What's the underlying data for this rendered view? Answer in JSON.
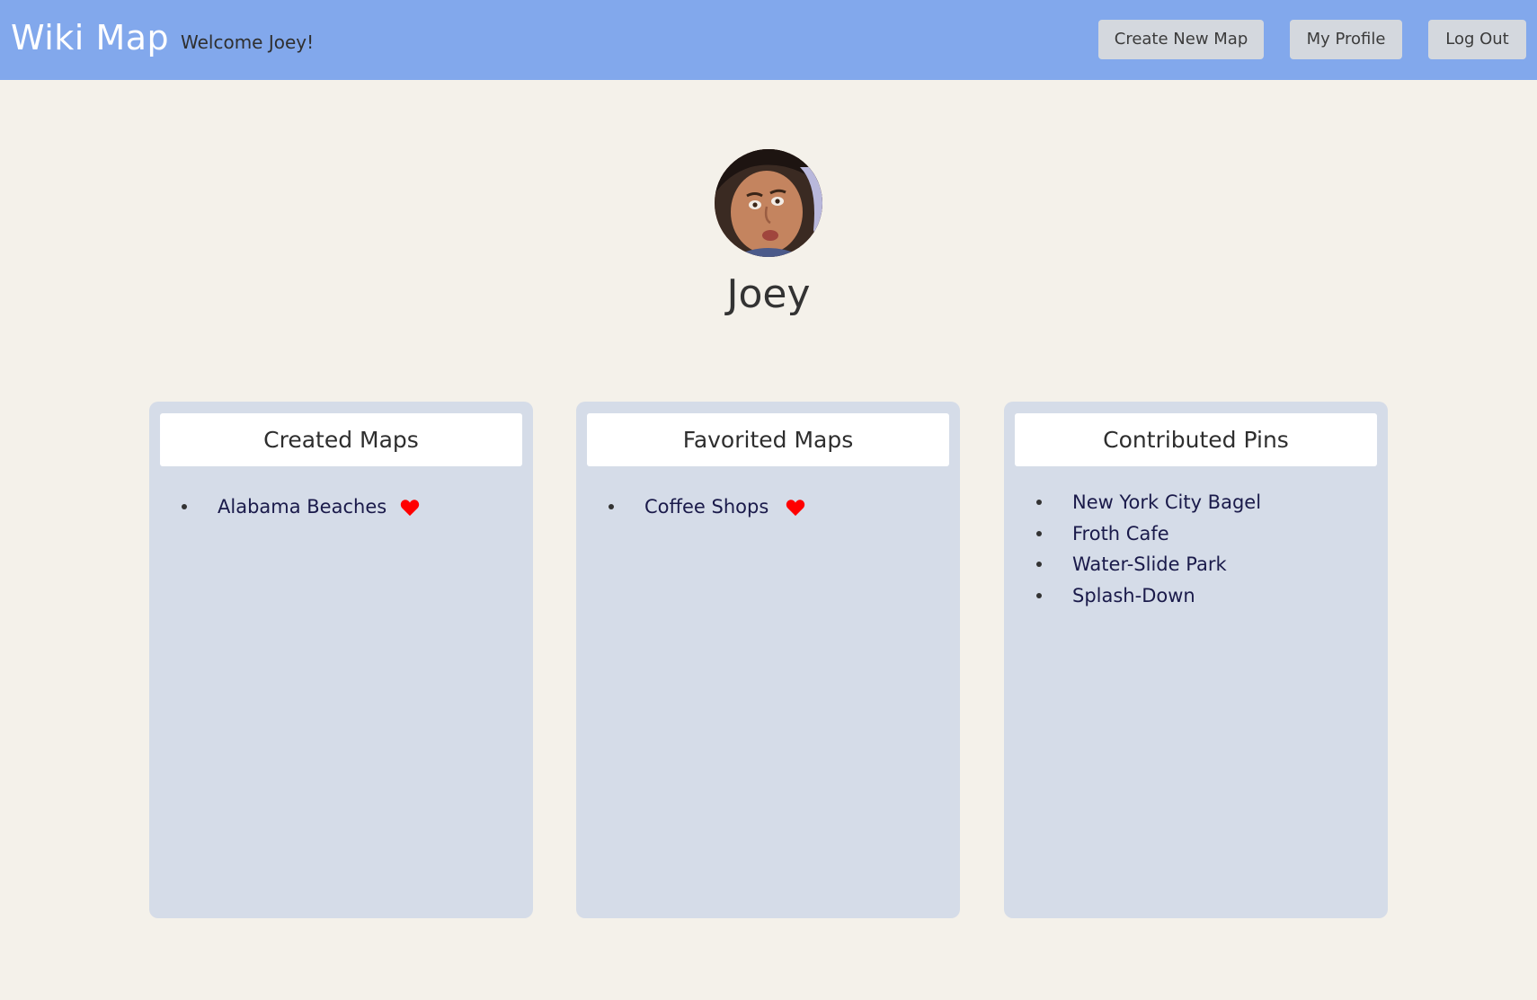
{
  "header": {
    "brand": "Wiki Map",
    "welcome": "Welcome Joey!",
    "buttons": {
      "create_new_map": "Create New Map",
      "my_profile": "My Profile",
      "log_out": "Log Out"
    }
  },
  "profile": {
    "name": "Joey",
    "avatar": "profile-photo"
  },
  "cards": {
    "created": {
      "title": "Created Maps",
      "items": [
        {
          "label": "Alabama Beaches",
          "icon": "heart-icon"
        }
      ]
    },
    "favorited": {
      "title": "Favorited Maps",
      "items": [
        {
          "label": "Coffee Shops",
          "icon": "heart-icon"
        }
      ]
    },
    "pins": {
      "title": "Contributed Pins",
      "items": [
        {
          "label": "New York City Bagel"
        },
        {
          "label": "Froth Cafe"
        },
        {
          "label": "Water-Slide Park"
        },
        {
          "label": "Splash-Down"
        }
      ]
    }
  },
  "colors": {
    "navbar": "#82a8ec",
    "background": "#f4f1ea",
    "card": "#d5dce8",
    "heart": "#ff0000",
    "link_text": "#1a1a4a"
  }
}
